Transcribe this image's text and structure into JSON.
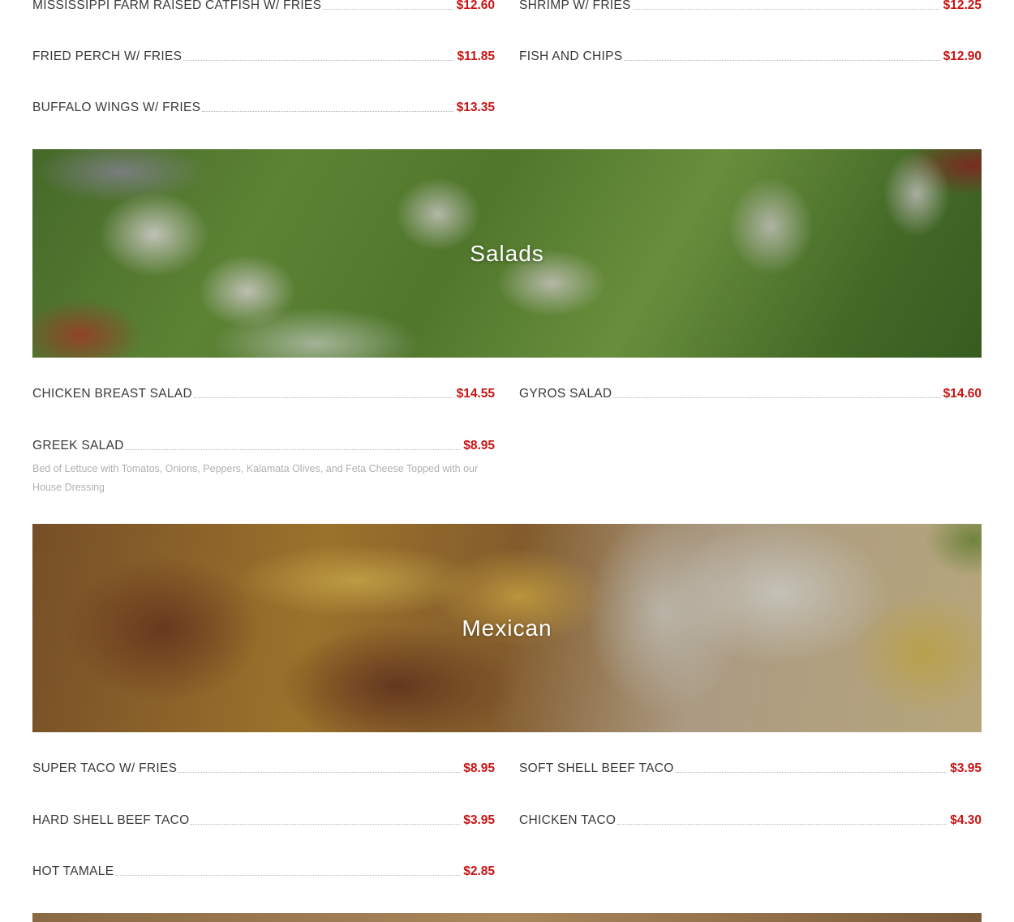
{
  "sections": {
    "fish": {
      "items": [
        {
          "name": "MISSISSIPPI FARM RAISED CATFISH W/ FRIES",
          "price": "$12.60"
        },
        {
          "name": "SHRIMP W/ FRIES",
          "price": "$12.25"
        },
        {
          "name": "FRIED PERCH W/ FRIES",
          "price": "$11.85"
        },
        {
          "name": "FISH AND CHIPS",
          "price": "$12.90"
        },
        {
          "name": "BUFFALO WINGS W/ FRIES",
          "price": "$13.35"
        }
      ]
    },
    "salads": {
      "title": "Salads",
      "items": [
        {
          "name": "CHICKEN BREAST SALAD",
          "price": "$14.55"
        },
        {
          "name": "GYROS SALAD",
          "price": "$14.60"
        },
        {
          "name": "GREEK SALAD",
          "price": "$8.95",
          "description": "Bed of Lettuce with Tomatos, Onions, Peppers, Kalamata Olives, and Feta Cheese Topped with our House Dressing"
        }
      ]
    },
    "mexican": {
      "title": "Mexican",
      "items": [
        {
          "name": "SUPER TACO W/ FRIES",
          "price": "$8.95"
        },
        {
          "name": "SOFT SHELL BEEF TACO",
          "price": "$3.95"
        },
        {
          "name": "HARD SHELL BEEF TACO",
          "price": "$3.95"
        },
        {
          "name": "CHICKEN TACO",
          "price": "$4.30"
        },
        {
          "name": "HOT TAMALE",
          "price": "$2.85"
        }
      ]
    }
  },
  "colors": {
    "price": "#c81414",
    "text": "#3a3a3a",
    "description": "#b0b0b0"
  }
}
